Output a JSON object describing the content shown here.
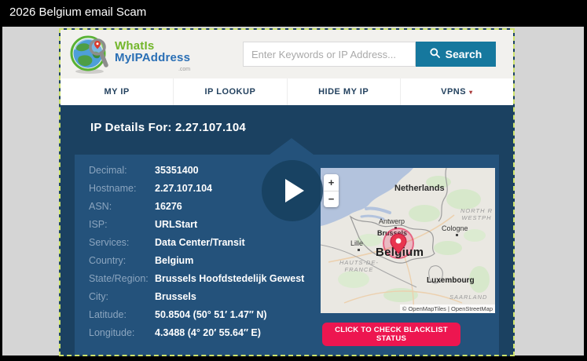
{
  "window": {
    "title": "2026 Belgium email Scam"
  },
  "site": {
    "brand": {
      "line1": "WhatIs",
      "line2": "MyIPAddress",
      "tld": ".com"
    },
    "search": {
      "placeholder": "Enter Keywords or IP Address...",
      "button_label": "Search"
    },
    "nav": [
      {
        "label": "MY IP"
      },
      {
        "label": "IP LOOKUP"
      },
      {
        "label": "HIDE MY IP"
      },
      {
        "label": "VPNS",
        "caret": "▾"
      }
    ]
  },
  "ip_details": {
    "heading": "IP Details For: 2.27.107.104",
    "rows": [
      {
        "label": "Decimal:",
        "value": "35351400"
      },
      {
        "label": "Hostname:",
        "value": "2.27.107.104"
      },
      {
        "label": "ASN:",
        "value": "16276"
      },
      {
        "label": "ISP:",
        "value": "URLStart"
      },
      {
        "label": "Services:",
        "value": "Data Center/Transit"
      },
      {
        "label": "State/Region:",
        "value": "Brussels Hoofdstedelijk Gewest"
      },
      {
        "label": "Country:",
        "value": "Belgium"
      },
      {
        "label": "City:",
        "value": "Brussels"
      },
      {
        "label": "Latitude:",
        "value": "50.8504 (50° 51′ 1.47″ N)"
      },
      {
        "label": "Longitude:",
        "value": "4.3488 (4° 20′ 55.64″ E)"
      }
    ],
    "blacklist_button": "CLICK TO CHECK BLACKLIST STATUS"
  },
  "map": {
    "zoom_in": "+",
    "zoom_out": "−",
    "labels": {
      "netherlands": "Netherlands",
      "region_de_line1": "NORTH R",
      "region_de_line2": "WESTPH",
      "antwerp": "Antwerp",
      "brussels": "Brussels",
      "belgium": "Belgium",
      "lille": "Lille",
      "cologne": "Cologne",
      "hauts_line1": "HAUTS-DE-",
      "hauts_line2": "FRANCE",
      "luxembourg": "Luxembourg",
      "saarland": "SAARLAND"
    },
    "attribution": "© OpenMapTiles | OpenStreetMap"
  },
  "colors": {
    "accent_teal": "#16789E",
    "accent_red": "#ED1650",
    "navy_dark": "#1B4161",
    "navy_panel": "#24527B",
    "selection_dash": "#CDE26B",
    "logo_green": "#72B62A",
    "logo_blue": "#2A6FB5"
  }
}
